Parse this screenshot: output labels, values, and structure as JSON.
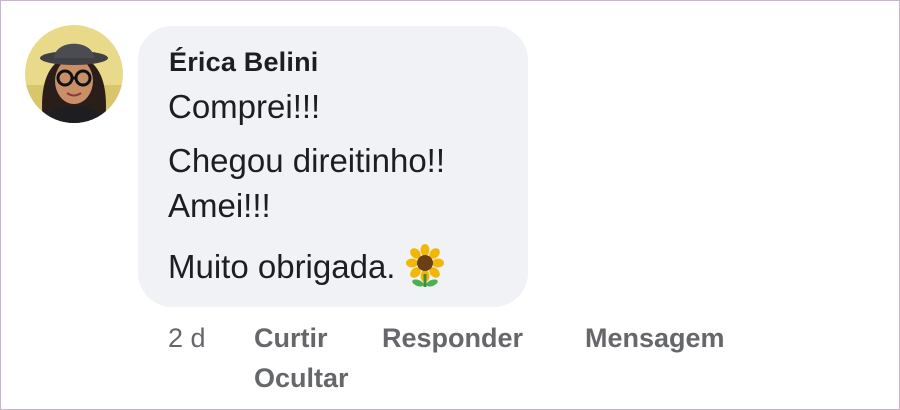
{
  "comment": {
    "author": "Érica Belini",
    "lines": [
      "Comprei!!!",
      "Chegou direitinho!!",
      "Amei!!!",
      "Muito obrigada."
    ],
    "emoji_icon": "sunflower-icon"
  },
  "meta": {
    "time": "2 d",
    "actions": {
      "like": "Curtir",
      "reply": "Responder",
      "message": "Mensagem",
      "hide": "Ocultar"
    }
  },
  "colors": {
    "bubble": "#f0f2f5",
    "text": "#1c1e21",
    "meta": "#65676b"
  }
}
